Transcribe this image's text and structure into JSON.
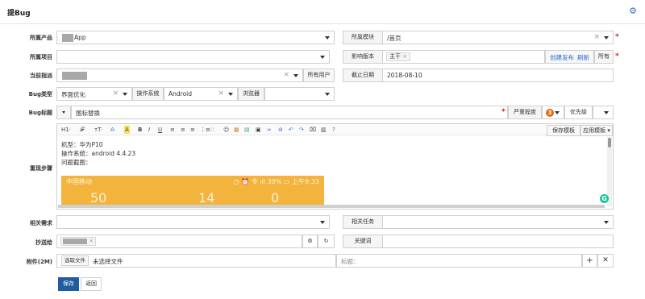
{
  "header": {
    "title": "提Bug",
    "settings_icon": "gear-icon"
  },
  "product": {
    "label": "所属产品",
    "value": "App"
  },
  "module": {
    "label": "所属模块",
    "value": "/首页"
  },
  "project": {
    "label": "所属项目",
    "value": ""
  },
  "build": {
    "label": "影响版本",
    "tag": "主干",
    "create_link": "创建发布",
    "refresh_link": "刷新",
    "all_button": "所有"
  },
  "assign": {
    "label": "当前指派",
    "all_users_button": "所有用户"
  },
  "deadline": {
    "label": "截止日期",
    "value": "2018-08-10"
  },
  "bug_type": {
    "label": "Bug类型",
    "value": "界面优化"
  },
  "os": {
    "label": "操作系统",
    "value": "Android"
  },
  "browser": {
    "label": "浏览器",
    "value": ""
  },
  "bug_title": {
    "label": "Bug标题",
    "value": "图标替换"
  },
  "severity": {
    "label": "严重程度",
    "value": "3"
  },
  "priority": {
    "label": "优先级",
    "value": ""
  },
  "steps": {
    "label": "重现步骤",
    "toolbar": {
      "heading": "H1·",
      "font": "𝓕·",
      "size": "тT·",
      "save_template": "保存模板",
      "apply_template": "应用模板"
    },
    "lines": [
      "机型：华为P10",
      "操作系统：android 4.4.23",
      "问题截图："
    ],
    "image_text": {
      "left": "中国移动",
      "status": "◷ ⏰ 令 ıll 39% ▭ 上午9:33",
      "num1": "50",
      "num2": "14",
      "num3": "0"
    }
  },
  "story": {
    "label": "相关需求",
    "value": ""
  },
  "task": {
    "label": "相关任务",
    "value": ""
  },
  "cc": {
    "label": "抄送给"
  },
  "keywords": {
    "label": "关键词",
    "value": ""
  },
  "files": {
    "label": "附件(2M)",
    "choose_button": "选取文件",
    "no_file": "未选择文件",
    "title_placeholder": "标题："
  },
  "actions": {
    "save": "保存",
    "back": "返回"
  },
  "colors": {
    "primary": "#1f5d9e",
    "required": "#d62020",
    "severity_badge": "#e36b10",
    "image_bg": "#f2b43c",
    "grammarly": "#15c39a"
  }
}
